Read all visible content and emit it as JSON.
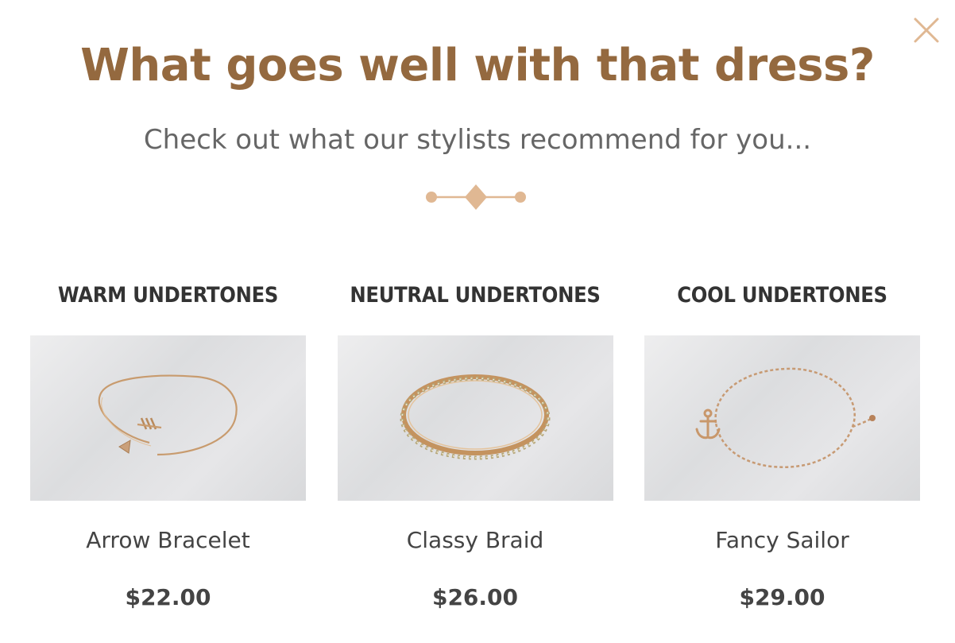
{
  "modal": {
    "title": "What goes well with that dress?",
    "subtitle": "Check out what our stylists recommend for you...",
    "close_icon": "close-icon",
    "accent_color": "#94693f",
    "divider_color": "#e0b893"
  },
  "columns": [
    {
      "heading": "WARM UNDERTONES",
      "product": {
        "name": "Arrow Bracelet",
        "price": "$22.00",
        "image": "arrow-bracelet-image"
      }
    },
    {
      "heading": "NEUTRAL UNDERTONES",
      "product": {
        "name": "Classy Braid",
        "price": "$26.00",
        "image": "braid-bangle-image"
      }
    },
    {
      "heading": "COOL UNDERTONES",
      "product": {
        "name": "Fancy Sailor",
        "price": "$29.00",
        "image": "anchor-chain-bracelet-image"
      }
    }
  ]
}
